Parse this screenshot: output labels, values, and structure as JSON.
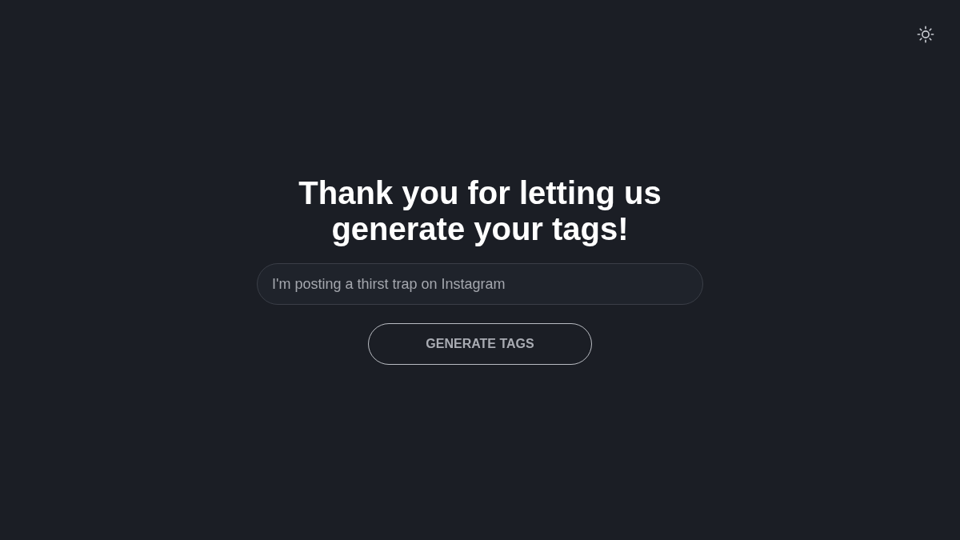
{
  "theme_toggle": {
    "dark_mode": true
  },
  "heading": "Thank you for letting us generate your tags!",
  "prompt_field": {
    "placeholder": "I'm posting a thirst trap on Instagram"
  },
  "submit_button": {
    "label": "GENERATE TAGS"
  }
}
